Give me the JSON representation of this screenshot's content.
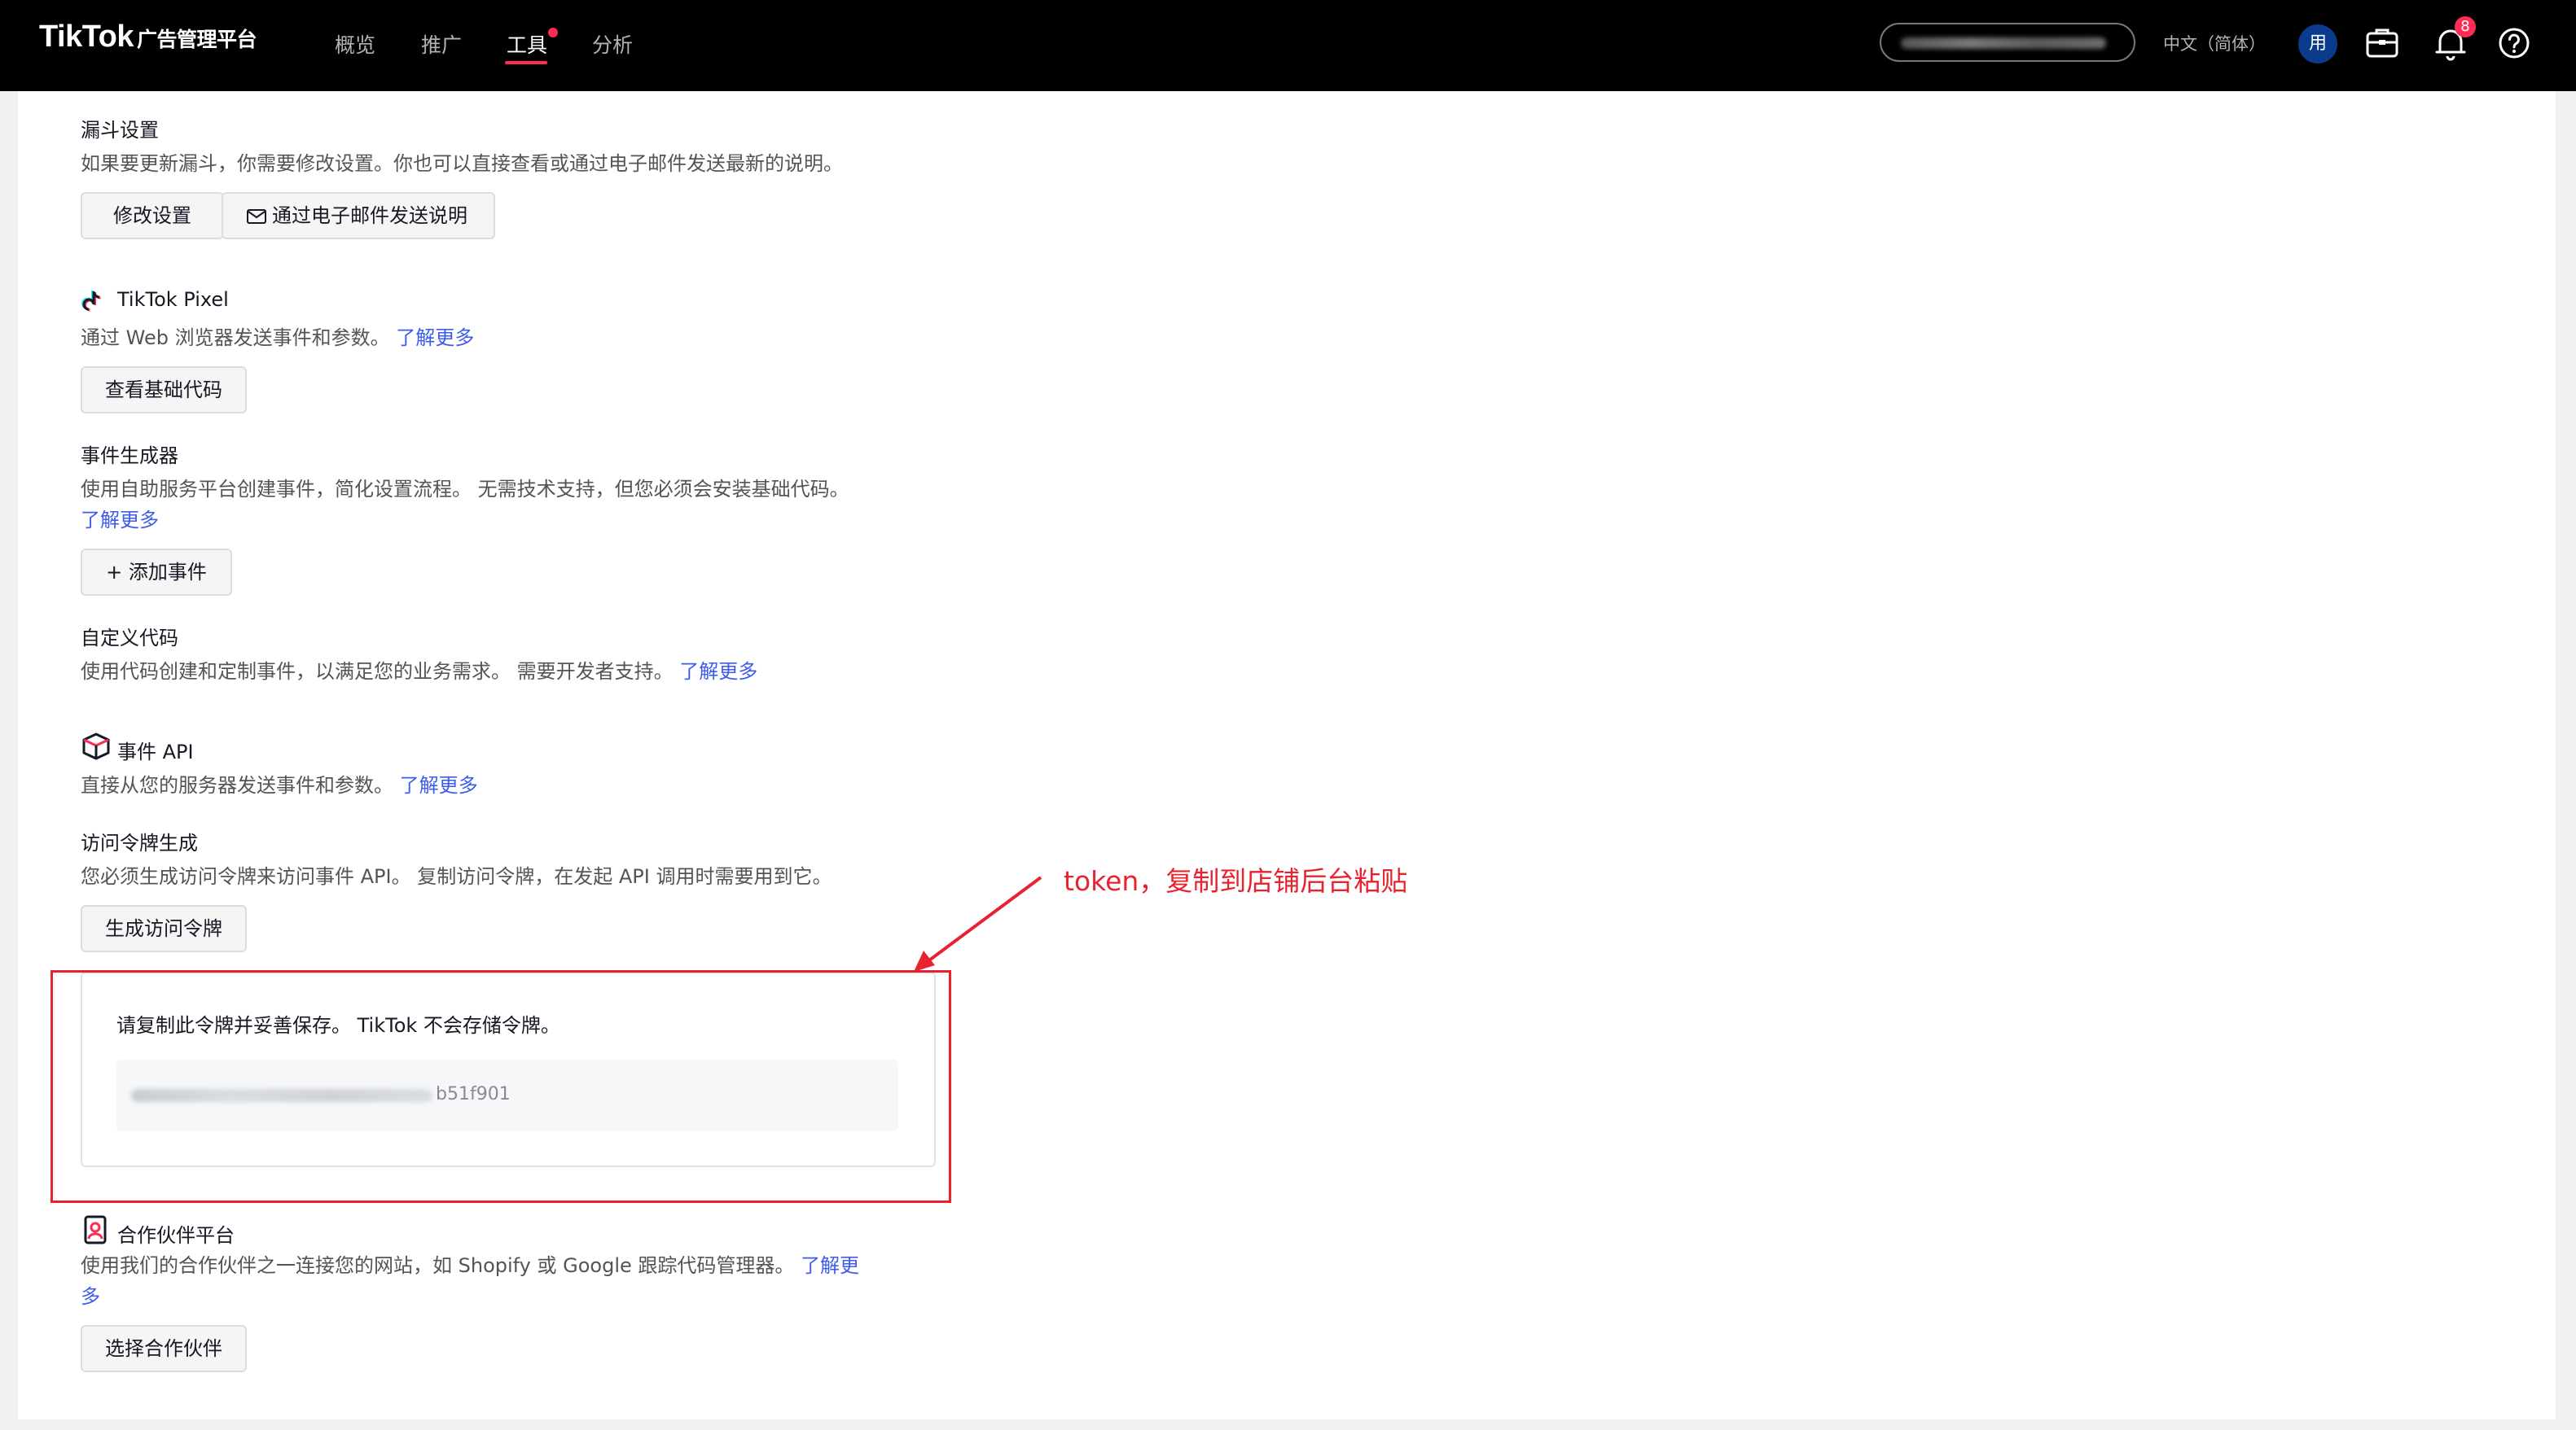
{
  "header": {
    "logo_main": "TikTok",
    "logo_sub": "广告管理平台",
    "nav": [
      {
        "label": "概览"
      },
      {
        "label": "推广"
      },
      {
        "label": "工具"
      },
      {
        "label": "分析"
      }
    ],
    "active_nav": "工具",
    "language": "中文（简体）",
    "avatar_text": "用",
    "notification_count": "8",
    "accent_color": "#fe2c55"
  },
  "funnel": {
    "title": "漏斗设置",
    "desc": "如果要更新漏斗，你需要修改设置。你也可以直接查看或通过电子邮件发送最新的说明。",
    "btn_modify": "修改设置",
    "btn_email": "通过电子邮件发送说明"
  },
  "pixel": {
    "title": "TikTok Pixel",
    "desc": "通过 Web 浏览器发送事件和参数。",
    "link": "了解更多",
    "btn": "查看基础代码"
  },
  "event_builder": {
    "title": "事件生成器",
    "desc": "使用自助服务平台创建事件，简化设置流程。 无需技术支持，但您必须会安装基础代码。",
    "link": "了解更多",
    "btn": "+ 添加事件"
  },
  "custom_code": {
    "title": "自定义代码",
    "desc": "使用代码创建和定制事件，以满足您的业务需求。 需要开发者支持。",
    "link": "了解更多"
  },
  "events_api": {
    "title": "事件 API",
    "desc": "直接从您的服务器发送事件和参数。",
    "link": "了解更多"
  },
  "access_token": {
    "title": "访问令牌生成",
    "desc": "您必须生成访问令牌来访问事件 API。 复制访问令牌，在发起 API 调用时需要用到它。",
    "btn": "生成访问令牌",
    "notice": "请复制此令牌并妥善保存。 TikTok 不会存储令牌。",
    "token_visible_tail": "b51f901"
  },
  "partner": {
    "title": "合作伙伴平台",
    "desc_line1": "使用我们的合作伙伴之一连接您的网站，如 Shopify 或 Google 跟踪代码管理器。",
    "link_line1": "了解更",
    "link_line2": "多",
    "btn": "选择合作伙伴"
  },
  "annotation": {
    "text": "token，复制到店铺后台粘贴",
    "color": "#e8232f"
  },
  "icons": [
    "mail-icon",
    "tiktok-pixel-icon",
    "events-api-cube-icon",
    "partner-platform-icon",
    "briefcase-icon",
    "bell-icon",
    "help-icon"
  ]
}
